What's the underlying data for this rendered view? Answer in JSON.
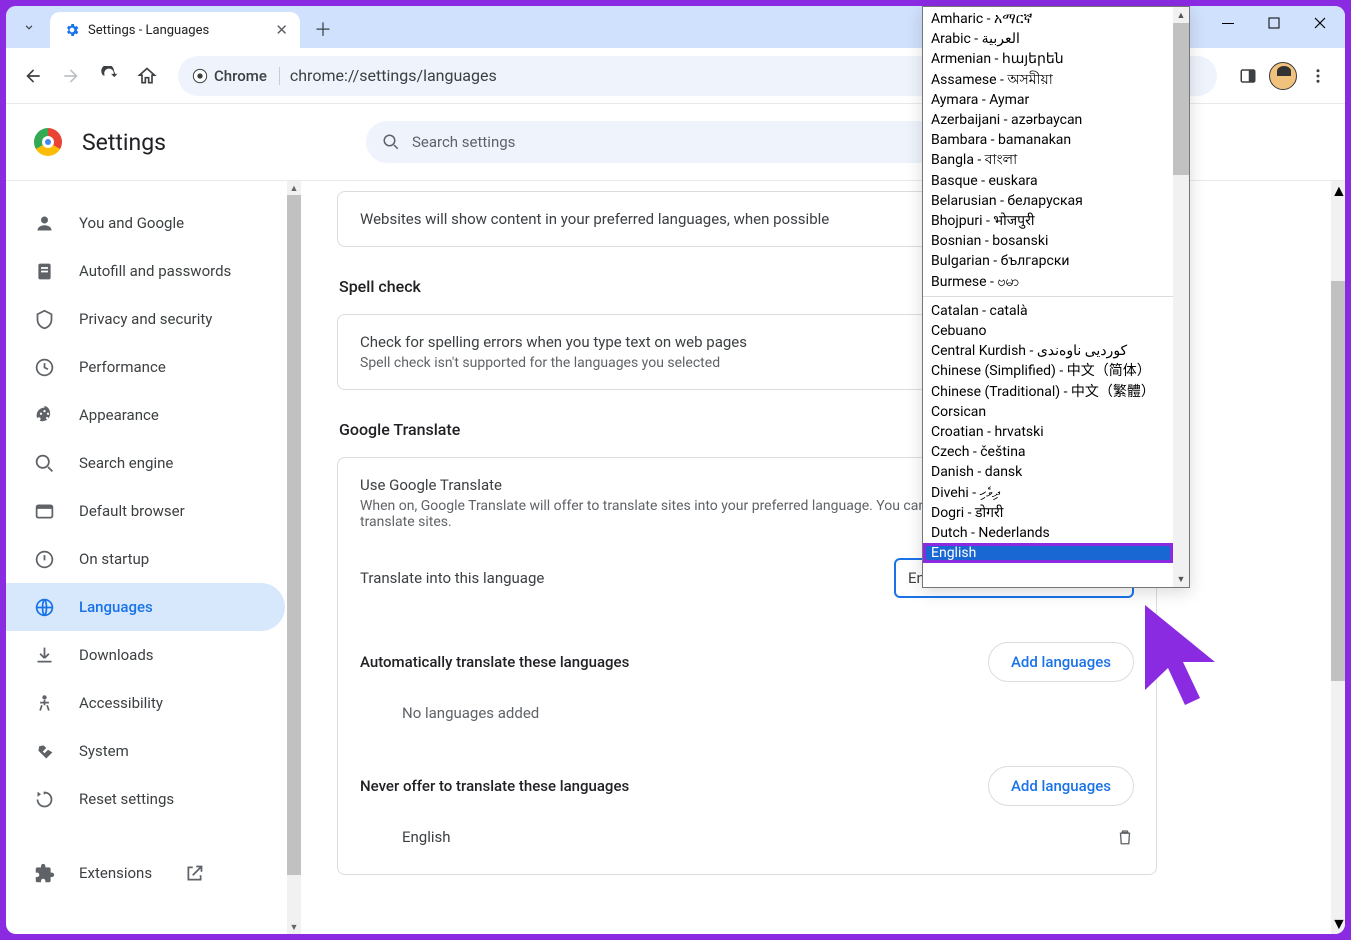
{
  "tab": {
    "title": "Settings - Languages"
  },
  "toolbar": {
    "chip": "Chrome",
    "url": "chrome://settings/languages"
  },
  "appbar": {
    "title": "Settings",
    "search_placeholder": "Search settings"
  },
  "sidebar": {
    "items": [
      {
        "label": "You and Google"
      },
      {
        "label": "Autofill and passwords"
      },
      {
        "label": "Privacy and security"
      },
      {
        "label": "Performance"
      },
      {
        "label": "Appearance"
      },
      {
        "label": "Search engine"
      },
      {
        "label": "Default browser"
      },
      {
        "label": "On startup"
      },
      {
        "label": "Languages"
      },
      {
        "label": "Downloads"
      },
      {
        "label": "Accessibility"
      },
      {
        "label": "System"
      },
      {
        "label": "Reset settings"
      },
      {
        "label": "Extensions"
      }
    ]
  },
  "content": {
    "pref_card": "Websites will show content in your preferred languages, when possible",
    "spell_heading": "Spell check",
    "spell_title": "Check for spelling errors when you type text on web pages",
    "spell_sub": "Spell check isn't supported for the languages you selected",
    "gt_heading": "Google Translate",
    "gt_title": "Use Google Translate",
    "gt_sub": "When on, Google Translate will offer to translate sites into your preferred language. You can also choose to automatically translate sites.",
    "translate_label": "Translate into this language",
    "translate_selected": "English",
    "auto_heading": "Automatically translate these languages",
    "add_btn": "Add languages",
    "no_lang": "No languages added",
    "never_heading": "Never offer to translate these languages",
    "never_item": "English"
  },
  "dropdown": {
    "groups": [
      [
        "Amharic - አማርኛ",
        "Arabic - العربية",
        "Armenian - հայերեն",
        "Assamese - অসমীয়া",
        "Aymara - Aymar",
        "Azerbaijani - azərbaycan",
        "Bambara - bamanakan",
        "Bangla - বাংলা",
        "Basque - euskara",
        "Belarusian - беларуская",
        "Bhojpuri - भोजपुरी",
        "Bosnian - bosanski",
        "Bulgarian - български",
        "Burmese - ဗမာ"
      ],
      [
        "Catalan - català",
        "Cebuano",
        "Central Kurdish - کوردیی ناوەندی",
        "Chinese (Simplified) - 中文（简体）",
        "Chinese (Traditional) - 中文（繁體）",
        "Corsican",
        "Croatian - hrvatski",
        "Czech - čeština",
        "Danish - dansk",
        "Divehi - ދިވެހި",
        "Dogri - डोगरी",
        "Dutch - Nederlands",
        "English"
      ]
    ],
    "selected": "English"
  }
}
